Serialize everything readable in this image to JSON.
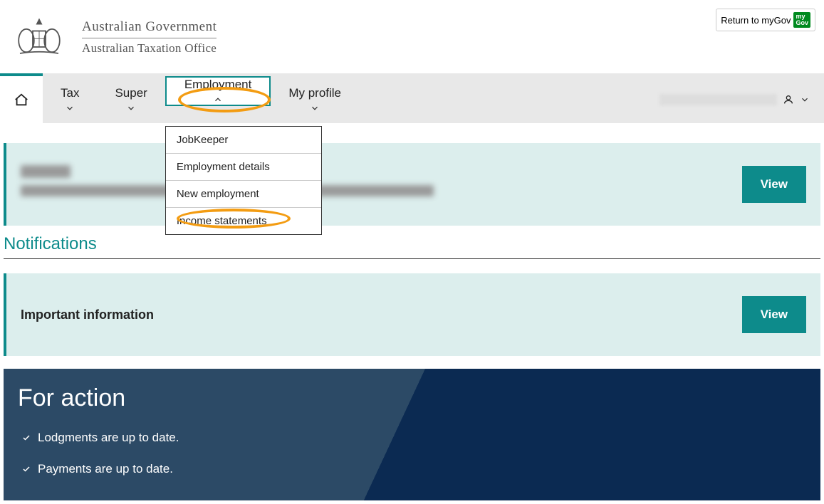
{
  "mygov_link": "Return to myGov",
  "mygov_badge": "myGov",
  "logo": {
    "line1": "Australian Government",
    "line2": "Australian Taxation Office"
  },
  "nav": {
    "tax": "Tax",
    "super": "Super",
    "employment": "Employment",
    "my_profile": "My profile"
  },
  "employment_menu": {
    "jobkeeper": "JobKeeper",
    "employment_details": "Employment details",
    "new_employment": "New employment",
    "income_statements": "Income statements"
  },
  "view_label": "View",
  "notifications_heading": "Notifications",
  "important_info": "Important information",
  "for_action": {
    "heading": "For action",
    "lodgments": "Lodgments are up to date.",
    "payments": "Payments are up to date."
  }
}
